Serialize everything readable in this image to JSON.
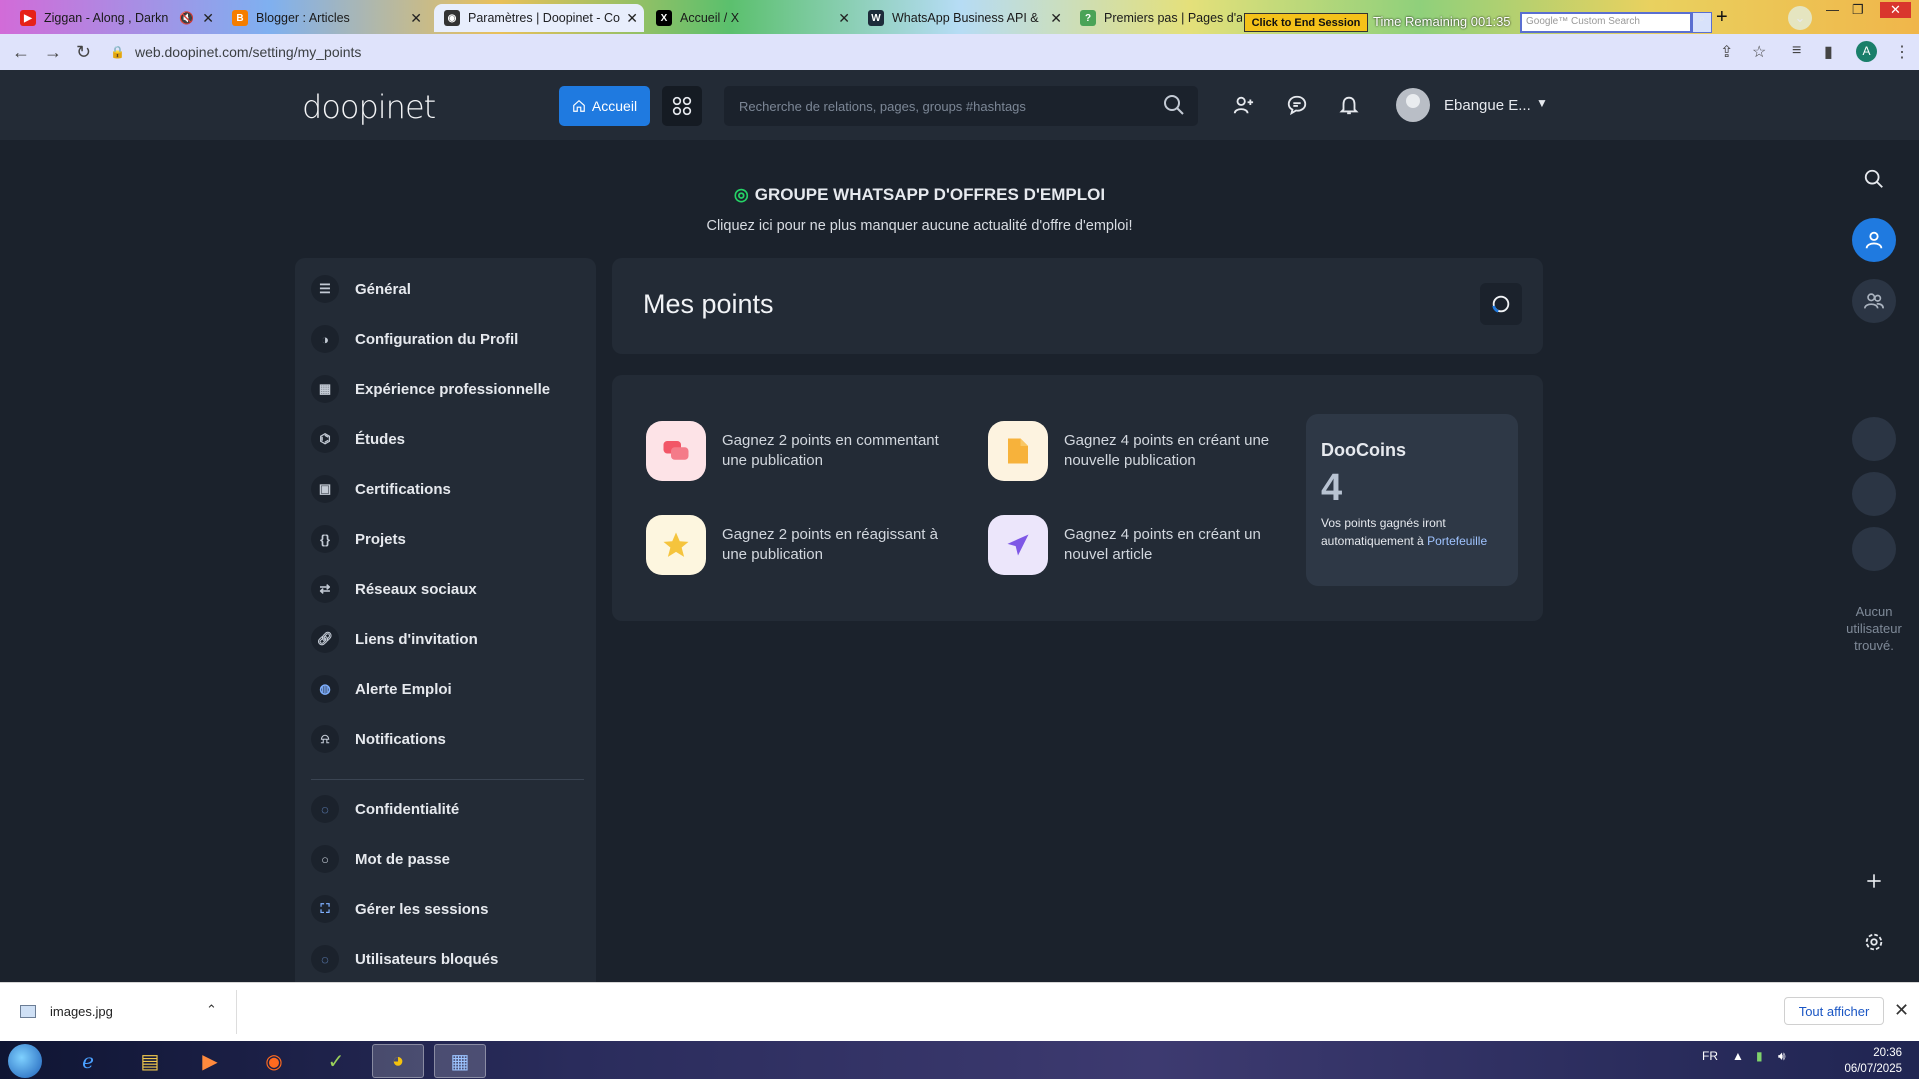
{
  "browser": {
    "tabs": [
      {
        "title": "Ziggan - Along , Darkn",
        "favicon": "youtube-icon",
        "color": "#e62117",
        "active": false
      },
      {
        "title": "Blogger : Articles",
        "favicon": "blogger-icon",
        "color": "#f57d00",
        "active": false
      },
      {
        "title": "Paramètres | Doopinet - Co",
        "favicon": "doopinet-icon",
        "color": "#333333",
        "active": true
      },
      {
        "title": "Accueil / X",
        "favicon": "x-icon",
        "color": "#000000",
        "active": false
      },
      {
        "title": "WhatsApp Business API &",
        "favicon": "whatsapp-icon",
        "color": "#1d2b3a",
        "active": false
      },
      {
        "title": "Premiers pas | Pages d'aid",
        "favicon": "help-icon",
        "color": "#4aa357",
        "active": false
      }
    ],
    "session_button": "Click to End Session",
    "time_remaining": "Time Remaining 001:35",
    "search_placeholder": "Google™ Custom Search",
    "url": "web.doopinet.com/setting/my_points",
    "profile_initial": "A"
  },
  "header": {
    "logo": "doopinet",
    "home_label": "Accueil",
    "search_placeholder": "Recherche de relations, pages, groups #hashtags",
    "user_name": "Ebangue E...",
    "accent": "#1f7ae0"
  },
  "banner": {
    "title": "GROUPE WHATSAPP D'OFFRES D'EMPLOI",
    "subtitle": "Cliquez ici pour ne plus manquer aucune actualité d'offre d'emploi!"
  },
  "sidebar": {
    "items": [
      {
        "label": "Général",
        "icon": "sliders-icon"
      },
      {
        "label": "Configuration du Profil",
        "icon": "profile-config-icon"
      },
      {
        "label": "Expérience professionnelle",
        "icon": "building-icon"
      },
      {
        "label": "Études",
        "icon": "graduation-icon"
      },
      {
        "label": "Certifications",
        "icon": "certificate-icon"
      },
      {
        "label": "Projets",
        "icon": "code-braces-icon"
      },
      {
        "label": "Réseaux sociaux",
        "icon": "share-arrows-icon"
      },
      {
        "label": "Liens d'invitation",
        "icon": "link-icon"
      },
      {
        "label": "Alerte Emploi",
        "icon": "briefcase-icon"
      },
      {
        "label": "Notifications",
        "icon": "bell-icon"
      },
      {
        "label": "Confidentialité",
        "icon": "privacy-icon"
      },
      {
        "label": "Mot de passe",
        "icon": "key-icon"
      },
      {
        "label": "Gérer les sessions",
        "icon": "sessions-icon"
      },
      {
        "label": "Utilisateurs bloqués",
        "icon": "blocked-users-icon"
      }
    ]
  },
  "main": {
    "title": "Mes points",
    "earn_items": [
      {
        "text": "Gagnez 2 points en commentant une publication",
        "icon": "comment-icon",
        "bg": "#fde3e7",
        "fg": "#f25667"
      },
      {
        "text": "Gagnez 4 points en créant une nouvelle publication",
        "icon": "document-icon",
        "bg": "#fdf3e0",
        "fg": "#f7b23b"
      },
      {
        "text": "Gagnez 2 points en réagissant à une publication",
        "icon": "star-icon",
        "bg": "#fdf6df",
        "fg": "#f5c43d"
      },
      {
        "text": "Gagnez 4 points en créant un nouvel article",
        "icon": "send-icon",
        "bg": "#ece6fb",
        "fg": "#7e57e6"
      }
    ],
    "doocoins": {
      "title": "DooCoins",
      "value": "4",
      "note": "Vos points gagnés iront automatiquement à",
      "link": "Portefeuille"
    }
  },
  "right_rail": {
    "empty_text": "Aucun utilisateur trouvé."
  },
  "downloads": {
    "file": "images.jpg",
    "show_all": "Tout afficher"
  },
  "taskbar": {
    "language": "FR",
    "time": "20:36",
    "date": "06/07/2025"
  }
}
